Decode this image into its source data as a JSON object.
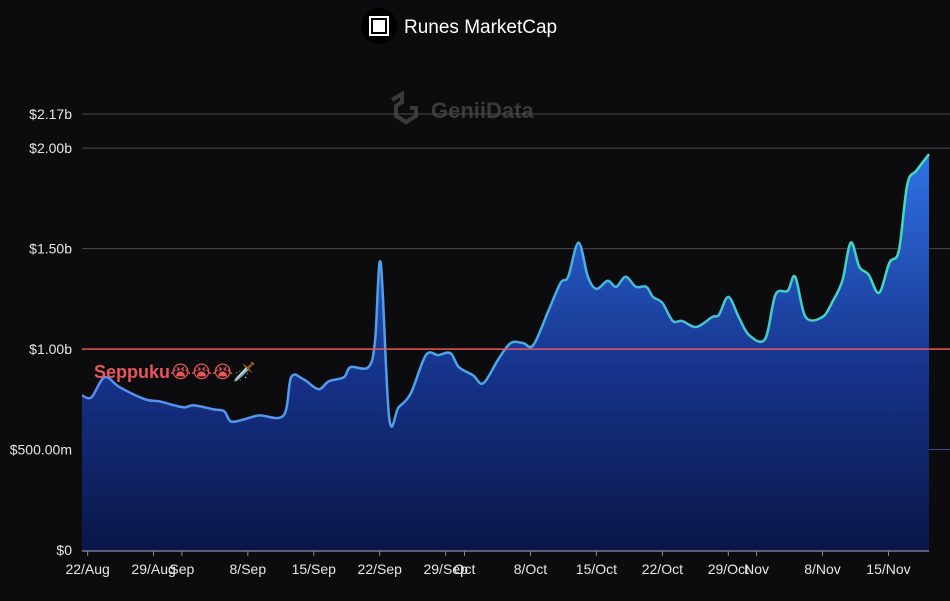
{
  "chart_data": {
    "type": "area",
    "title": "Runes MarketCap",
    "watermark": "GeniiData",
    "xlabel": "",
    "ylabel": "",
    "ylim": [
      0,
      2.17
    ],
    "y_unit": "billion USD",
    "y_ticks": [
      {
        "value": 0,
        "label": "$0"
      },
      {
        "value": 0.5,
        "label": "$500.00m"
      },
      {
        "value": 1.0,
        "label": "$1.00b"
      },
      {
        "value": 1.5,
        "label": "$1.50b"
      },
      {
        "value": 2.0,
        "label": "$2.00b"
      },
      {
        "value": 2.17,
        "label": "$2.17b"
      }
    ],
    "x_unit": "days since 22/Aug",
    "xlim": [
      -0.6,
      89.3
    ],
    "x_ticks": [
      {
        "value": 0,
        "label": "22/Aug"
      },
      {
        "value": 7,
        "label": "29/Aug"
      },
      {
        "value": 10,
        "label": "Sep"
      },
      {
        "value": 17,
        "label": "8/Sep"
      },
      {
        "value": 24,
        "label": "15/Sep"
      },
      {
        "value": 31,
        "label": "22/Sep"
      },
      {
        "value": 38,
        "label": "29/Sep"
      },
      {
        "value": 40,
        "label": "Oct"
      },
      {
        "value": 47,
        "label": "8/Oct"
      },
      {
        "value": 54,
        "label": "15/Oct"
      },
      {
        "value": 61,
        "label": "22/Oct"
      },
      {
        "value": 68,
        "label": "29/Oct"
      },
      {
        "value": 71,
        "label": "Nov"
      },
      {
        "value": 78,
        "label": "8/Nov"
      },
      {
        "value": 85,
        "label": "15/Nov"
      }
    ],
    "series": [
      {
        "name": "Runes MarketCap",
        "x": [
          -0.6,
          0.4,
          1.8,
          3.4,
          6.1,
          7.6,
          9.2,
          10.3,
          11.3,
          13.4,
          14.5,
          15.2,
          16.6,
          18.2,
          20.8,
          21.6,
          22.9,
          24.5,
          25.6,
          27.2,
          27.9,
          29.8,
          30.5,
          31.1,
          32,
          33,
          34.3,
          35.9,
          37.2,
          38.5,
          39.4,
          40.9,
          42,
          43.6,
          44.9,
          46.2,
          47.3,
          48.9,
          50.2,
          51,
          52.1,
          53.1,
          54,
          55.2,
          56.1,
          57.1,
          58.2,
          59.3,
          60,
          61,
          62.1,
          63.1,
          64.6,
          66.3,
          67,
          68,
          69.1,
          70.2,
          71.9,
          73,
          74.3,
          75.1,
          76.2,
          78,
          79.1,
          80.1,
          81,
          81.9,
          82.9,
          84,
          85.1,
          86.1,
          87,
          88,
          89.3
        ],
        "values": [
          0.77,
          0.76,
          0.86,
          0.81,
          0.75,
          0.74,
          0.72,
          0.71,
          0.72,
          0.7,
          0.69,
          0.64,
          0.65,
          0.67,
          0.67,
          0.86,
          0.85,
          0.8,
          0.84,
          0.86,
          0.91,
          0.91,
          1.04,
          1.43,
          0.66,
          0.71,
          0.78,
          0.97,
          0.97,
          0.98,
          0.91,
          0.87,
          0.83,
          0.95,
          1.03,
          1.03,
          1.02,
          1.19,
          1.33,
          1.36,
          1.53,
          1.36,
          1.3,
          1.34,
          1.31,
          1.36,
          1.31,
          1.31,
          1.26,
          1.23,
          1.14,
          1.14,
          1.11,
          1.16,
          1.17,
          1.26,
          1.16,
          1.07,
          1.05,
          1.27,
          1.29,
          1.36,
          1.16,
          1.16,
          1.24,
          1.34,
          1.53,
          1.41,
          1.37,
          1.28,
          1.43,
          1.49,
          1.82,
          1.89,
          1.97
        ]
      }
    ],
    "reference_line": {
      "value": 1.0,
      "color": "#e8555a",
      "label": "Seppuku😭😭😭🗡️"
    },
    "grid": true,
    "legend": "top-center",
    "colors": {
      "line_start": "#5b8cf0",
      "line_end": "#3ee0b8",
      "fill_top": "#2f6fe0",
      "fill_bottom": "#0b1a4a"
    }
  }
}
